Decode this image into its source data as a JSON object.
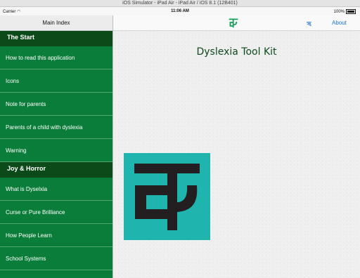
{
  "window": {
    "title": "iOS Simulator - iPad Air - iPad Air / iOS 8.1 (12B401)"
  },
  "status_bar": {
    "carrier": "Carrier",
    "time": "11:06 AM",
    "battery": "100%"
  },
  "sidebar": {
    "title": "Main Index",
    "sections": [
      {
        "header": "The Start",
        "items": [
          "How to read this application",
          "Icons",
          "Note for parents",
          "Parents of a child with dyslexia",
          "Warning"
        ]
      },
      {
        "header": "Joy & Horror",
        "items": [
          "What is Dyselxia",
          "Curse or Pure Brilliance",
          "How People Learn",
          "School Systems"
        ]
      }
    ]
  },
  "navbar": {
    "logo_icon": "ka-glyph-icon",
    "action_icon": "translate-icon",
    "about_label": "About"
  },
  "main": {
    "title": "Dyslexia Tool Kit",
    "logo_icon": "ka-glyph-logo"
  },
  "colors": {
    "sidebar_bg": "#0b7d3a",
    "section_bg": "#0c4a1a",
    "logo_teal": "#1fb5ae",
    "link_blue": "#1a6fe0",
    "logo_green": "#149e59"
  }
}
